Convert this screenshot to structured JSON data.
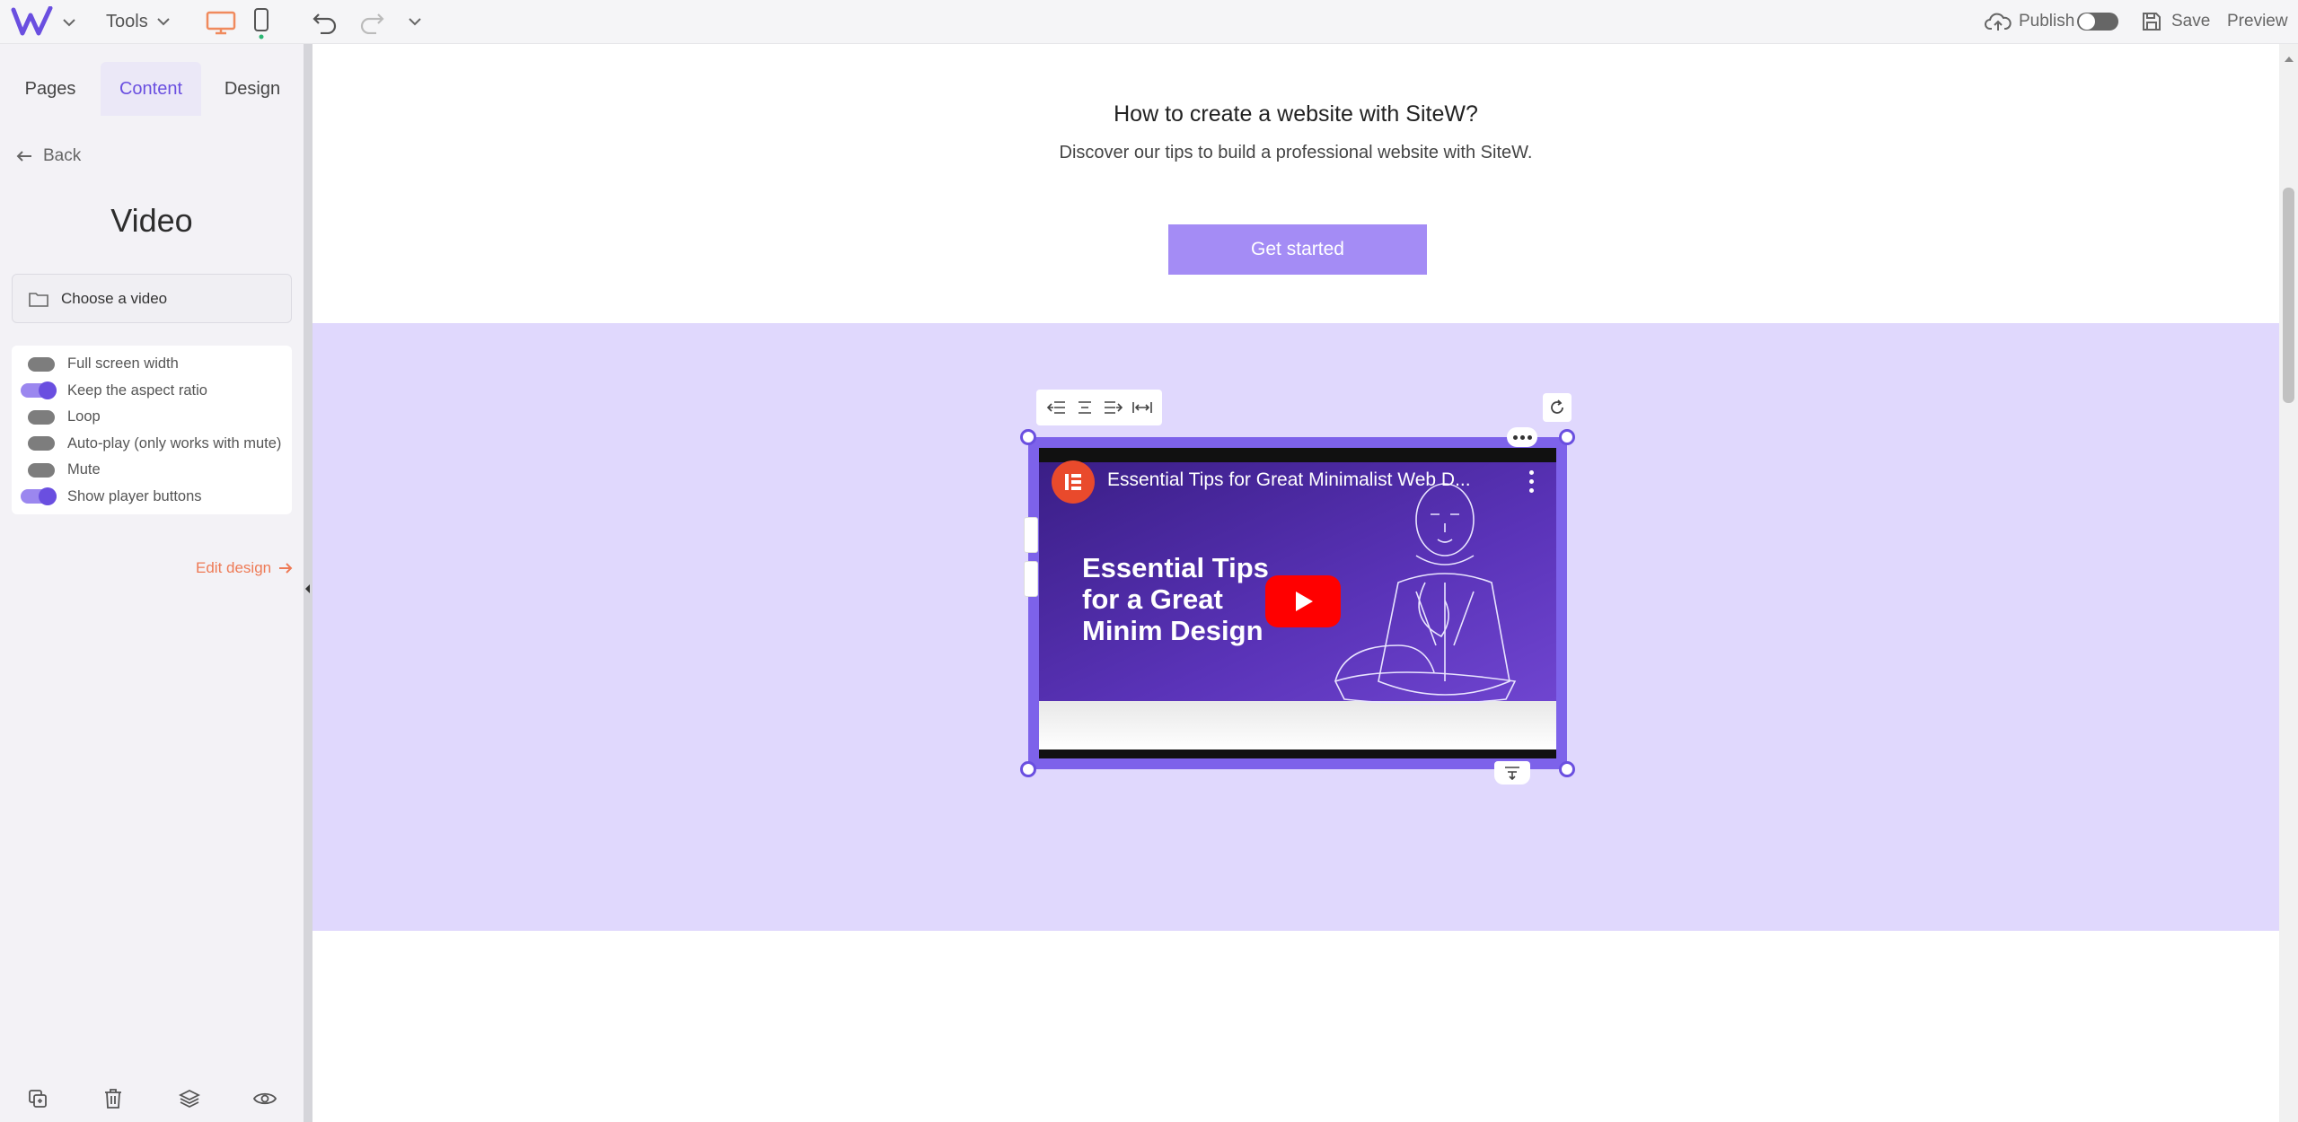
{
  "toolbar": {
    "tools_label": "Tools",
    "publish_label": "Publish",
    "save_label": "Save",
    "preview_label": "Preview",
    "colors": {
      "desktop_active": "#f08a5d",
      "accent": "#6a4fe0"
    }
  },
  "sidebar": {
    "tabs": [
      {
        "label": "Pages",
        "active": false
      },
      {
        "label": "Content",
        "active": true
      },
      {
        "label": "Design",
        "active": false
      }
    ],
    "back_label": "Back",
    "panel_title": "Video",
    "choose_video_label": "Choose a video",
    "options": [
      {
        "label": "Full screen width",
        "on": false
      },
      {
        "label": "Keep the aspect ratio",
        "on": true
      },
      {
        "label": "Loop",
        "on": false
      },
      {
        "label": "Auto-play (only works with mute)",
        "on": false
      },
      {
        "label": "Mute",
        "on": false
      },
      {
        "label": "Show player buttons",
        "on": true
      }
    ],
    "edit_design_label": "Edit design"
  },
  "canvas": {
    "hero_title": "How to create a website with SiteW?",
    "hero_subtitle": "Discover our tips to build a professional website with SiteW.",
    "cta_label": "Get started",
    "band_color": "#e0d8fd",
    "video": {
      "title": "Essential Tips for Great Minimalist Web D...",
      "headline": "Essential Tips for a Great Minim Design"
    }
  }
}
